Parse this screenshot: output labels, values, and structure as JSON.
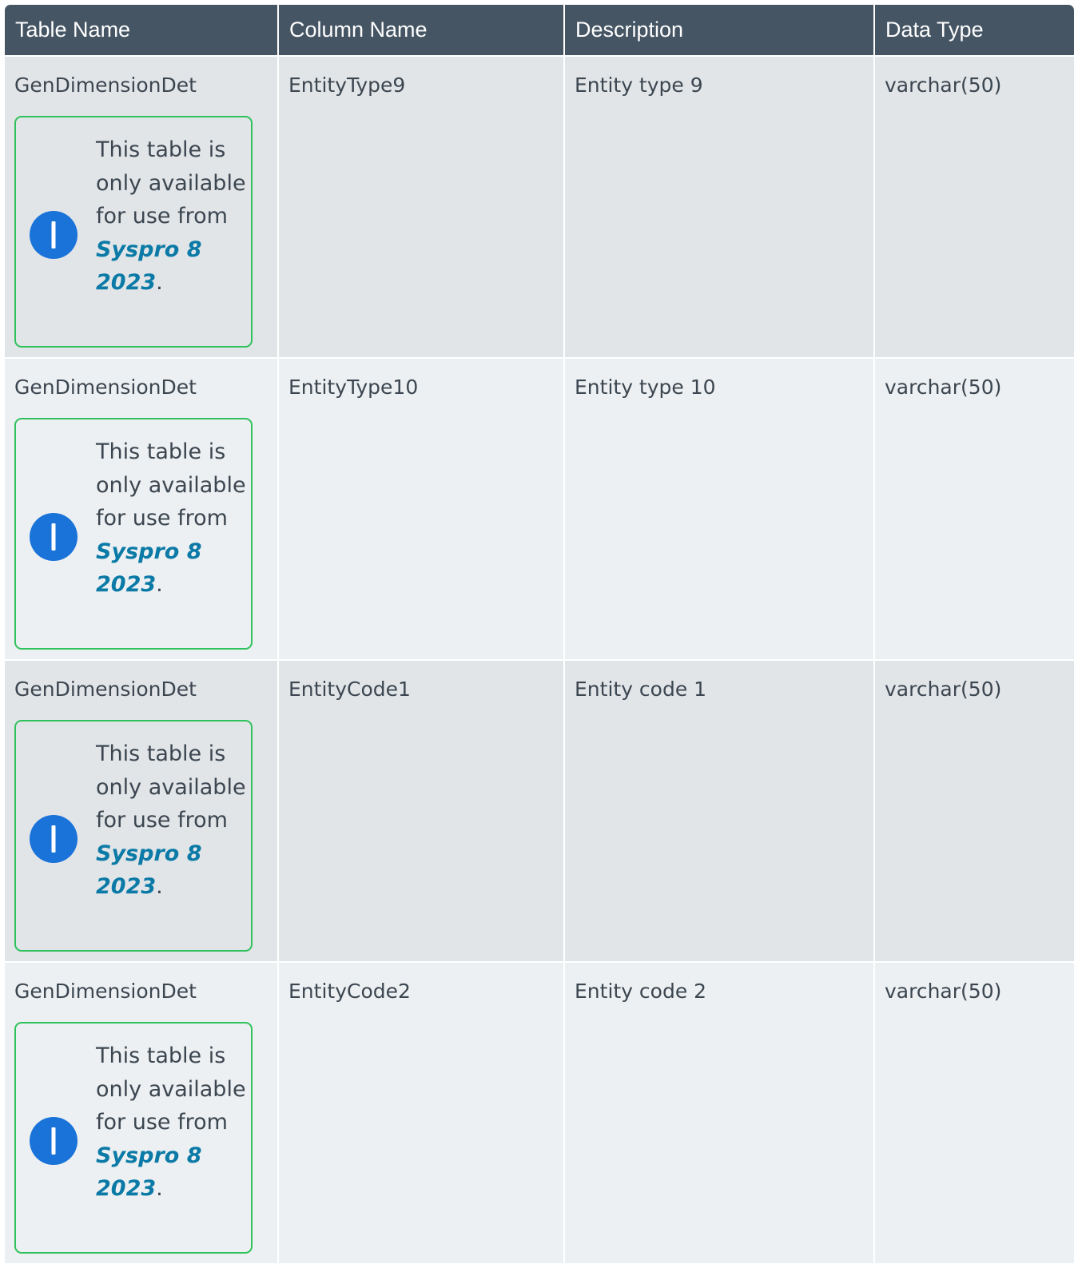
{
  "table": {
    "headers": [
      "Table Name",
      "Column Name",
      "Description",
      "Data Type"
    ],
    "rows": [
      {
        "table_name": "GenDimensionDet",
        "column_name": "EntityType9",
        "description": "Entity type 9",
        "data_type": "varchar(50)",
        "note": {
          "text": "This table is only available for use from",
          "version": "Syspro 8 2023",
          "suffix": "."
        }
      },
      {
        "table_name": "GenDimensionDet",
        "column_name": "EntityType10",
        "description": "Entity type 10",
        "data_type": "varchar(50)",
        "note": {
          "text": "This table is only available for use from",
          "version": "Syspro 8 2023",
          "suffix": "."
        }
      },
      {
        "table_name": "GenDimensionDet",
        "column_name": "EntityCode1",
        "description": "Entity code 1",
        "data_type": "varchar(50)",
        "note": {
          "text": "This table is only available for use from",
          "version": "Syspro 8 2023",
          "suffix": "."
        }
      },
      {
        "table_name": "GenDimensionDet",
        "column_name": "EntityCode2",
        "description": "Entity code 2",
        "data_type": "varchar(50)",
        "note": {
          "text": "This table is only available for use from",
          "version": "Syspro 8 2023",
          "suffix": "."
        }
      }
    ]
  },
  "icons": {
    "note_icon": "info-icon"
  },
  "colors": {
    "header_bg": "#455564",
    "row_odd_bg": "#e1e5e8",
    "row_even_bg": "#ecf0f2",
    "note_border": "#2fc25b",
    "info_icon": "#1a73d9",
    "version_link": "#0b7aa6"
  }
}
